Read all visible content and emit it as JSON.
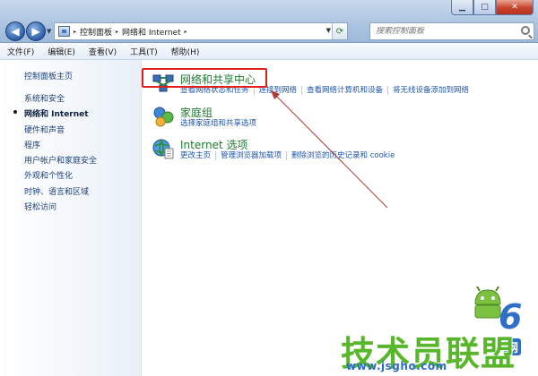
{
  "window": {
    "minimize_glyph": "▁",
    "maximize_glyph": "□",
    "close_glyph": "✕"
  },
  "address_bar": {
    "crumbs": [
      "控制面板",
      "网络和 Internet"
    ],
    "separator": "▸"
  },
  "search": {
    "placeholder": "搜索控制面板"
  },
  "menu": [
    "文件(F)",
    "编辑(E)",
    "查看(V)",
    "工具(T)",
    "帮助(H)"
  ],
  "sidebar": {
    "home": "控制面板主页",
    "items": [
      {
        "label": "系统和安全"
      },
      {
        "label": "网络和 Internet",
        "active": true
      },
      {
        "label": "硬件和声音"
      },
      {
        "label": "程序"
      },
      {
        "label": "用户帐户和家庭安全"
      },
      {
        "label": "外观和个性化"
      },
      {
        "label": "时钟、语言和区域"
      },
      {
        "label": "轻松访问"
      }
    ]
  },
  "categories": [
    {
      "title": "网络和共享中心",
      "icon": "network-sharing-center-icon",
      "links": [
        "查看网络状态和任务",
        "连接到网络",
        "查看网络计算机和设备",
        "将无线设备添加到网络"
      ]
    },
    {
      "title": "家庭组",
      "icon": "homegroup-icon",
      "links": [
        "选择家庭组和共享选项"
      ]
    },
    {
      "title": "Internet 选项",
      "icon": "internet-options-icon",
      "links": [
        "更改主页",
        "管理浏览器加载项",
        "删除浏览的历史记录和 cookie"
      ]
    }
  ],
  "colors": {
    "category_title": "#1e7a2e",
    "link": "#1f56b0",
    "highlight": "#e0201b",
    "arrow": "#b03a2e"
  },
  "watermark": {
    "brand": "技术员联盟",
    "url": "www.jsgho.com",
    "six": "6",
    "www": "网"
  }
}
